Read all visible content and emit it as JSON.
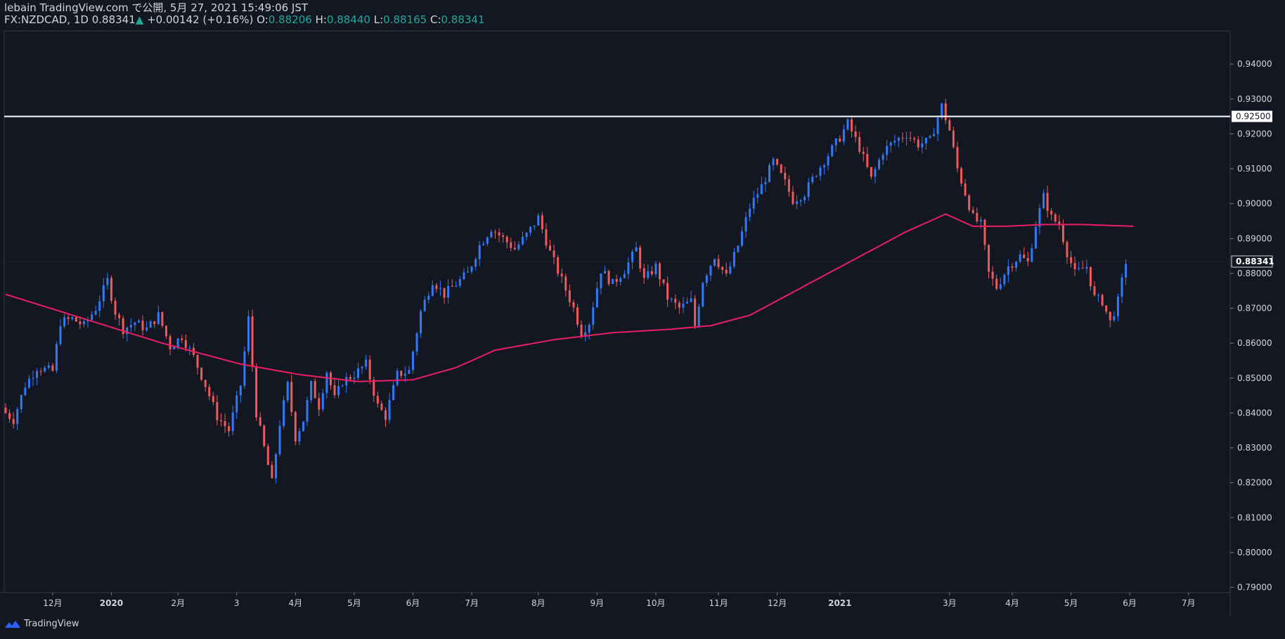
{
  "header": {
    "publish_line": "lebain TradingView.com で公開, 5月 27, 2021 15:49:06 JST",
    "symbol": "FX:NZDCAD, 1D",
    "last": "0.88341",
    "change_arrow": "▲",
    "change": "+0.00142 (+0.16%)",
    "o_label": "O:",
    "o_value": "0.88206",
    "h_label": "H:",
    "h_value": "0.88440",
    "l_label": "L:",
    "l_value": "0.88165",
    "c_label": "C:",
    "c_value": "0.88341"
  },
  "footer": {
    "brand": "TradingView"
  },
  "colors": {
    "background": "#131722",
    "up": "#3179f5",
    "down": "#f05a5a",
    "ma": "#e91e63",
    "hline": "#ffffff",
    "grid": "#363a45",
    "text": "#d1d4dc",
    "change": "#26a69a"
  },
  "chart_data": {
    "type": "candlestick",
    "price_axis": {
      "ticks": [
        "0.94000",
        "0.93000",
        "0.92000",
        "0.91000",
        "0.90000",
        "0.89000",
        "0.88000",
        "0.87000",
        "0.86000",
        "0.85000",
        "0.84000",
        "0.83000",
        "0.82000",
        "0.81000",
        "0.80000",
        "0.79000"
      ],
      "ylim": [
        0.7885,
        0.9495
      ]
    },
    "time_axis": {
      "ticks": [
        {
          "label": "12月",
          "i": 12
        },
        {
          "label": "2020",
          "i": 27
        },
        {
          "label": "2月",
          "i": 44
        },
        {
          "label": "3",
          "i": 59
        },
        {
          "label": "4月",
          "i": 74
        },
        {
          "label": "5月",
          "i": 89
        },
        {
          "label": "6月",
          "i": 104
        },
        {
          "label": "7月",
          "i": 119
        },
        {
          "label": "8月",
          "i": 136
        },
        {
          "label": "9月",
          "i": 151
        },
        {
          "label": "10月",
          "i": 166
        },
        {
          "label": "11月",
          "i": 182
        },
        {
          "label": "12月",
          "i": 197
        },
        {
          "label": "2021",
          "i": 213
        },
        {
          "label": "3月",
          "i": 241
        },
        {
          "label": "4月",
          "i": 257
        },
        {
          "label": "5月",
          "i": 272
        },
        {
          "label": "6月",
          "i": 287
        },
        {
          "label": "7月",
          "i": 302
        }
      ],
      "visible_bars": 313
    },
    "horizontal_line": {
      "value": 0.925,
      "label": "0.92500"
    },
    "last_price": {
      "value": 0.88341,
      "label": "0.88341"
    },
    "close_series": [
      {
        "i": 0,
        "v": 0.84
      },
      {
        "i": 2,
        "v": 0.838
      },
      {
        "i": 5,
        "v": 0.848
      },
      {
        "i": 8,
        "v": 0.853
      },
      {
        "i": 12,
        "v": 0.852
      },
      {
        "i": 14,
        "v": 0.866
      },
      {
        "i": 17,
        "v": 0.867
      },
      {
        "i": 20,
        "v": 0.865
      },
      {
        "i": 23,
        "v": 0.87
      },
      {
        "i": 26,
        "v": 0.878
      },
      {
        "i": 28,
        "v": 0.869
      },
      {
        "i": 30,
        "v": 0.864
      },
      {
        "i": 33,
        "v": 0.866
      },
      {
        "i": 36,
        "v": 0.864
      },
      {
        "i": 39,
        "v": 0.868
      },
      {
        "i": 42,
        "v": 0.859
      },
      {
        "i": 45,
        "v": 0.862
      },
      {
        "i": 48,
        "v": 0.856
      },
      {
        "i": 51,
        "v": 0.848
      },
      {
        "i": 54,
        "v": 0.839
      },
      {
        "i": 57,
        "v": 0.835
      },
      {
        "i": 60,
        "v": 0.848
      },
      {
        "i": 62,
        "v": 0.867
      },
      {
        "i": 64,
        "v": 0.84
      },
      {
        "i": 66,
        "v": 0.83
      },
      {
        "i": 68,
        "v": 0.82
      },
      {
        "i": 70,
        "v": 0.837
      },
      {
        "i": 72,
        "v": 0.848
      },
      {
        "i": 74,
        "v": 0.833
      },
      {
        "i": 76,
        "v": 0.838
      },
      {
        "i": 78,
        "v": 0.848
      },
      {
        "i": 80,
        "v": 0.842
      },
      {
        "i": 82,
        "v": 0.852
      },
      {
        "i": 84,
        "v": 0.844
      },
      {
        "i": 86,
        "v": 0.849
      },
      {
        "i": 89,
        "v": 0.851
      },
      {
        "i": 92,
        "v": 0.854
      },
      {
        "i": 95,
        "v": 0.842
      },
      {
        "i": 97,
        "v": 0.839
      },
      {
        "i": 100,
        "v": 0.851
      },
      {
        "i": 103,
        "v": 0.852
      },
      {
        "i": 106,
        "v": 0.869
      },
      {
        "i": 109,
        "v": 0.878
      },
      {
        "i": 112,
        "v": 0.874
      },
      {
        "i": 115,
        "v": 0.877
      },
      {
        "i": 118,
        "v": 0.88
      },
      {
        "i": 121,
        "v": 0.888
      },
      {
        "i": 124,
        "v": 0.893
      },
      {
        "i": 127,
        "v": 0.89
      },
      {
        "i": 130,
        "v": 0.887
      },
      {
        "i": 133,
        "v": 0.891
      },
      {
        "i": 136,
        "v": 0.896
      },
      {
        "i": 139,
        "v": 0.886
      },
      {
        "i": 142,
        "v": 0.878
      },
      {
        "i": 145,
        "v": 0.87
      },
      {
        "i": 147,
        "v": 0.863
      },
      {
        "i": 149,
        "v": 0.866
      },
      {
        "i": 152,
        "v": 0.881
      },
      {
        "i": 155,
        "v": 0.877
      },
      {
        "i": 158,
        "v": 0.881
      },
      {
        "i": 161,
        "v": 0.887
      },
      {
        "i": 163,
        "v": 0.878
      },
      {
        "i": 166,
        "v": 0.882
      },
      {
        "i": 169,
        "v": 0.873
      },
      {
        "i": 172,
        "v": 0.87
      },
      {
        "i": 175,
        "v": 0.872
      },
      {
        "i": 176,
        "v": 0.865
      },
      {
        "i": 178,
        "v": 0.878
      },
      {
        "i": 181,
        "v": 0.885
      },
      {
        "i": 184,
        "v": 0.879
      },
      {
        "i": 187,
        "v": 0.888
      },
      {
        "i": 190,
        "v": 0.899
      },
      {
        "i": 193,
        "v": 0.905
      },
      {
        "i": 196,
        "v": 0.912
      },
      {
        "i": 199,
        "v": 0.906
      },
      {
        "i": 201,
        "v": 0.901
      },
      {
        "i": 204,
        "v": 0.903
      },
      {
        "i": 207,
        "v": 0.909
      },
      {
        "i": 210,
        "v": 0.914
      },
      {
        "i": 213,
        "v": 0.919
      },
      {
        "i": 215,
        "v": 0.923
      },
      {
        "i": 218,
        "v": 0.916
      },
      {
        "i": 221,
        "v": 0.907
      },
      {
        "i": 224,
        "v": 0.915
      },
      {
        "i": 227,
        "v": 0.918
      },
      {
        "i": 230,
        "v": 0.92
      },
      {
        "i": 233,
        "v": 0.917
      },
      {
        "i": 236,
        "v": 0.918
      },
      {
        "i": 239,
        "v": 0.928
      },
      {
        "i": 241,
        "v": 0.921
      },
      {
        "i": 243,
        "v": 0.91
      },
      {
        "i": 245,
        "v": 0.903
      },
      {
        "i": 247,
        "v": 0.896
      },
      {
        "i": 249,
        "v": 0.894
      },
      {
        "i": 251,
        "v": 0.88
      },
      {
        "i": 253,
        "v": 0.876
      },
      {
        "i": 256,
        "v": 0.882
      },
      {
        "i": 259,
        "v": 0.885
      },
      {
        "i": 261,
        "v": 0.883
      },
      {
        "i": 263,
        "v": 0.894
      },
      {
        "i": 265,
        "v": 0.902
      },
      {
        "i": 267,
        "v": 0.896
      },
      {
        "i": 269,
        "v": 0.894
      },
      {
        "i": 271,
        "v": 0.886
      },
      {
        "i": 273,
        "v": 0.88
      },
      {
        "i": 276,
        "v": 0.882
      },
      {
        "i": 278,
        "v": 0.873
      },
      {
        "i": 280,
        "v": 0.872
      },
      {
        "i": 282,
        "v": 0.866
      },
      {
        "i": 284,
        "v": 0.872
      },
      {
        "i": 286,
        "v": 0.8834
      }
    ],
    "moving_average": [
      {
        "i": 0,
        "v": 0.874
      },
      {
        "i": 20,
        "v": 0.867
      },
      {
        "i": 40,
        "v": 0.86
      },
      {
        "i": 60,
        "v": 0.854
      },
      {
        "i": 75,
        "v": 0.851
      },
      {
        "i": 90,
        "v": 0.849
      },
      {
        "i": 104,
        "v": 0.8495
      },
      {
        "i": 115,
        "v": 0.853
      },
      {
        "i": 125,
        "v": 0.858
      },
      {
        "i": 140,
        "v": 0.861
      },
      {
        "i": 155,
        "v": 0.863
      },
      {
        "i": 170,
        "v": 0.864
      },
      {
        "i": 180,
        "v": 0.865
      },
      {
        "i": 190,
        "v": 0.868
      },
      {
        "i": 200,
        "v": 0.874
      },
      {
        "i": 210,
        "v": 0.88
      },
      {
        "i": 220,
        "v": 0.886
      },
      {
        "i": 230,
        "v": 0.892
      },
      {
        "i": 240,
        "v": 0.897
      },
      {
        "i": 247,
        "v": 0.8935
      },
      {
        "i": 255,
        "v": 0.8935
      },
      {
        "i": 265,
        "v": 0.894
      },
      {
        "i": 275,
        "v": 0.894
      },
      {
        "i": 288,
        "v": 0.8935
      }
    ]
  }
}
